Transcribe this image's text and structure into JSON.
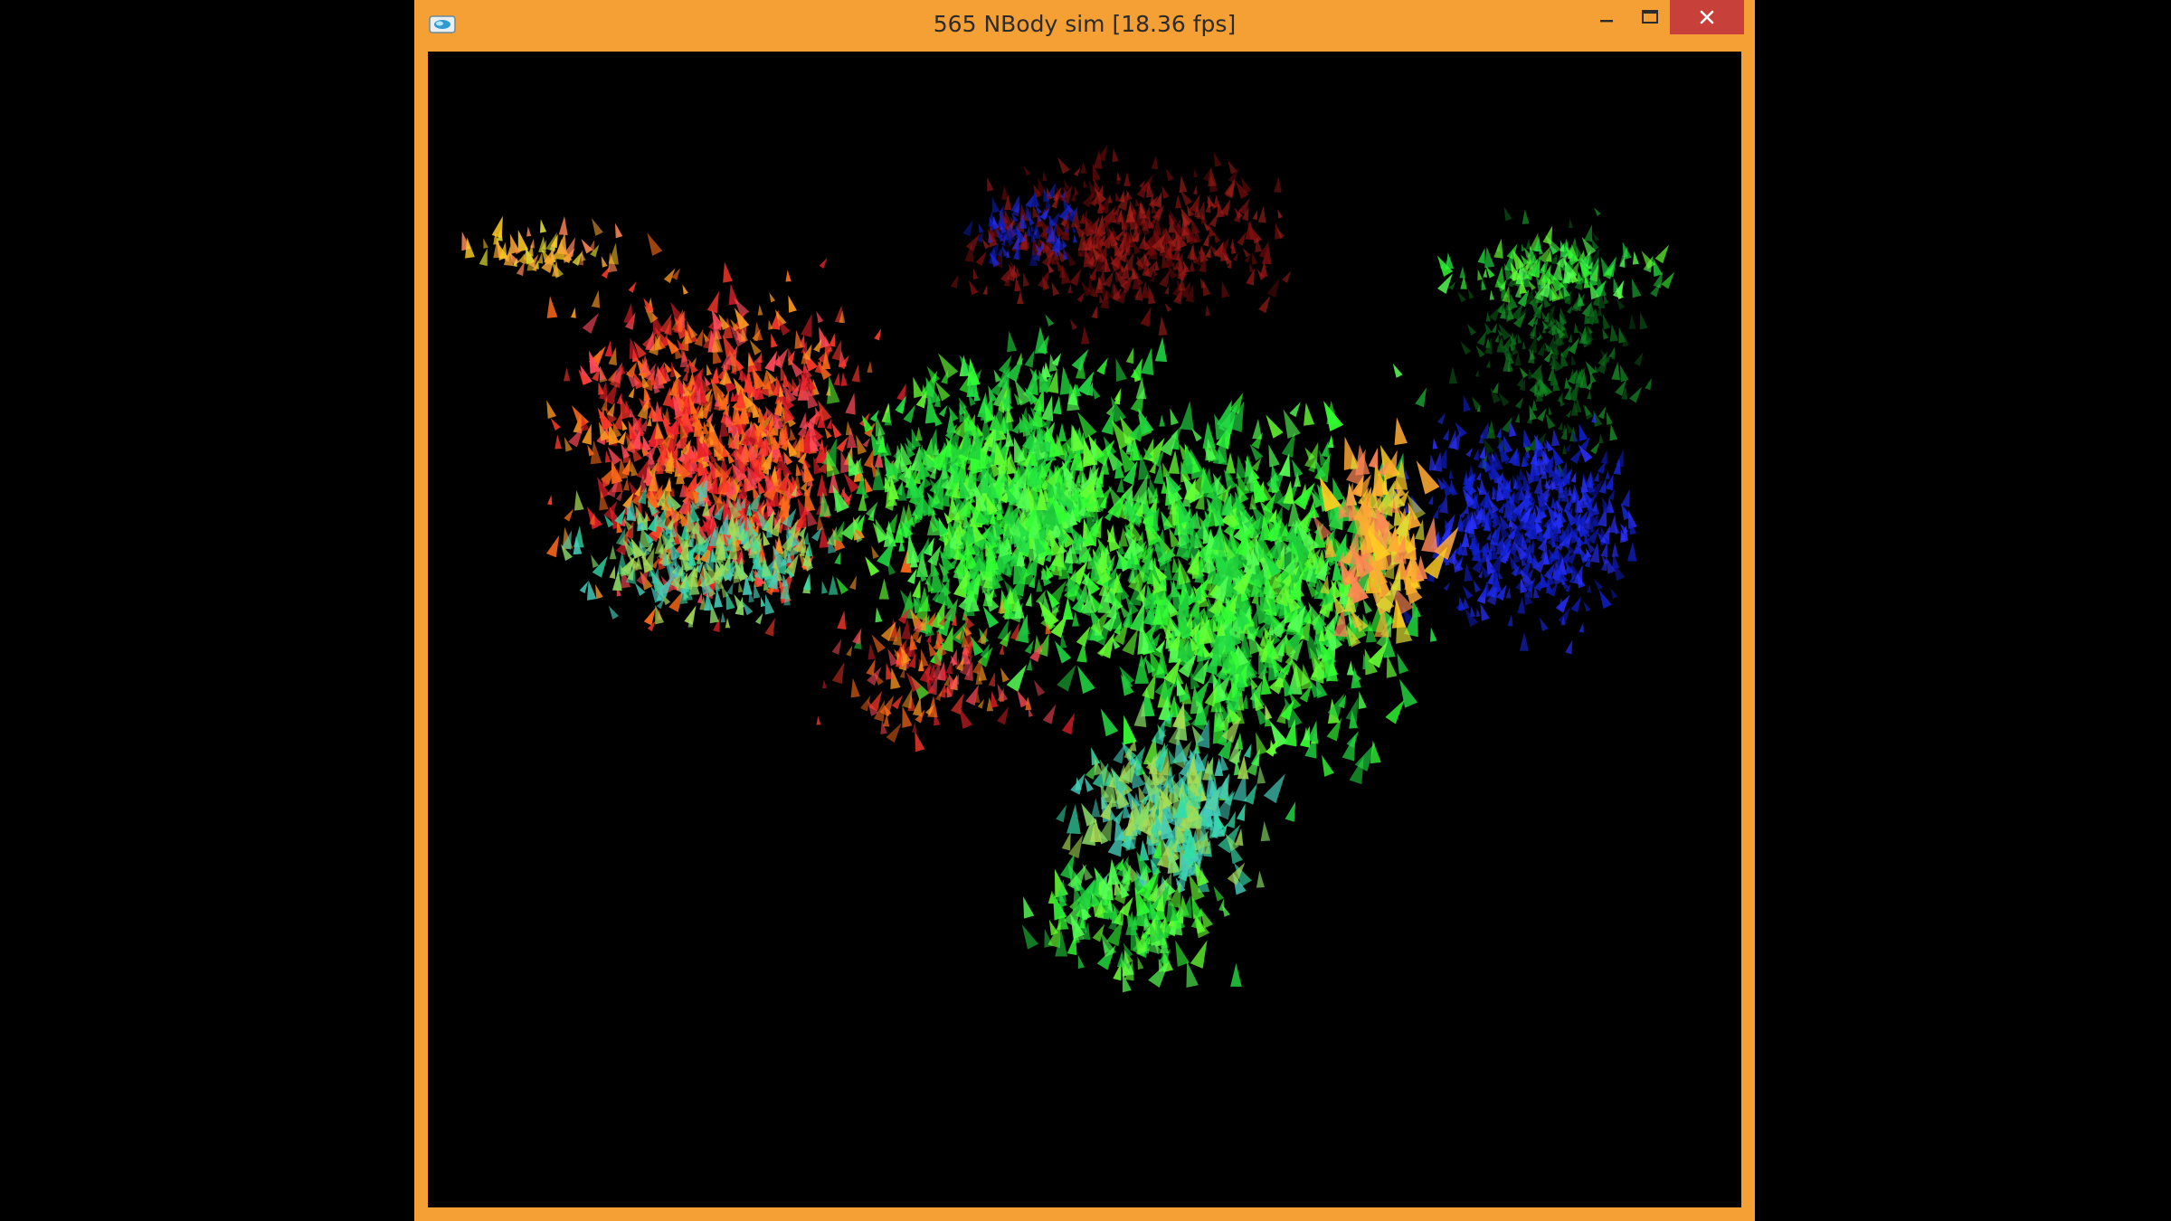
{
  "window": {
    "title": "565 NBody sim [18.36 fps]",
    "frame_color": "#f5a035",
    "close_hover_color": "#c7403a"
  },
  "controls": {
    "minimize_icon": "minimize-icon",
    "maximize_icon": "maximize-icon",
    "close_icon": "close-icon"
  },
  "scene": {
    "background": "#000000",
    "clusters": [
      {
        "name": "red-orange",
        "colors": [
          "#ff3a2a",
          "#ff6a1a",
          "#ff9a20",
          "#e8202a",
          "#ff4a5a"
        ]
      },
      {
        "name": "dark-red",
        "colors": [
          "#8a0f0f",
          "#a01818",
          "#6e0a0a",
          "#b0221a"
        ]
      },
      {
        "name": "green",
        "colors": [
          "#33ff33",
          "#22dd44",
          "#55ff55",
          "#1fcc3a",
          "#66ff33"
        ]
      },
      {
        "name": "teal-mix",
        "colors": [
          "#33ddaa",
          "#44ccbb",
          "#88dd66",
          "#aadd55"
        ]
      },
      {
        "name": "yellow-orange",
        "colors": [
          "#ffcc22",
          "#ffaa33",
          "#ff8855",
          "#dddd33"
        ]
      },
      {
        "name": "blue",
        "colors": [
          "#1020d0",
          "#1a2ae8",
          "#0d18a8",
          "#2a30ff"
        ]
      },
      {
        "name": "dark-green",
        "colors": [
          "#0a6a1a",
          "#118a22",
          "#0a5014",
          "#1a9a2a"
        ]
      }
    ]
  }
}
